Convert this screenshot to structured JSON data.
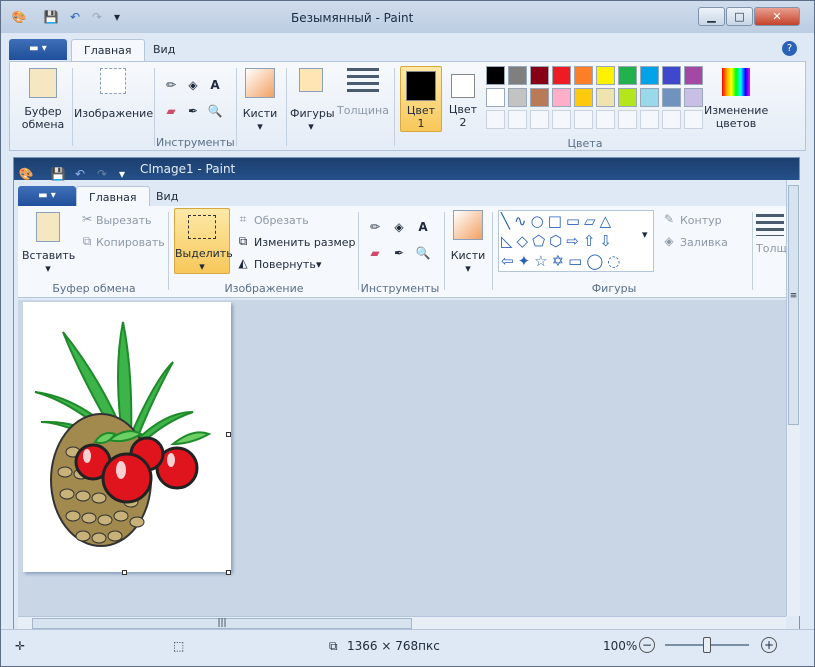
{
  "outer_window": {
    "title": "Безымянный - Paint",
    "tabs": [
      "Главная",
      "Вид"
    ],
    "groups": {
      "clipboard": [
        "Буфер",
        "обмена"
      ],
      "image": "Изображение",
      "tools": "Инструменты",
      "brushes": "Кисти",
      "shapes": "Фигуры",
      "size": "Толщина",
      "color1": [
        "Цвет",
        "1"
      ],
      "color2": [
        "Цвет",
        "2"
      ],
      "edit_colors": [
        "Изменение",
        "цветов"
      ],
      "colors_label": "Цвета"
    },
    "palette_row1": [
      "#000000",
      "#7f7f7f",
      "#880015",
      "#ed1c24",
      "#ff7f27",
      "#fff200",
      "#22b14c",
      "#00a2e8",
      "#3f48cc",
      "#a349a4"
    ],
    "palette_row2": [
      "#ffffff",
      "#c3c3c3",
      "#b97a57",
      "#ffaec9",
      "#ffc90e",
      "#efe4b0",
      "#b5e61d",
      "#99d9ea",
      "#7092be",
      "#c8bfe7"
    ]
  },
  "inner_window": {
    "title": "CImage1 - Paint",
    "tabs": [
      "Главная",
      "Вид"
    ],
    "paste": "Вставить",
    "cut": "Вырезать",
    "copy": "Копировать",
    "clipboard_label": "Буфер обмена",
    "select": "Выделить",
    "crop": "Обрезать",
    "resize": "Изменить размер",
    "rotate": "Повернуть",
    "image_label": "Изображение",
    "tools_label": "Инструменты",
    "brushes": "Кисти",
    "outline": "Контур",
    "fill": "Заливка",
    "shapes_label": "Фигуры",
    "size": "Толщи"
  },
  "status": {
    "dimensions": "1366 × 768пкс",
    "zoom": "100%"
  },
  "colors": {
    "accent": "#1f4f9a",
    "ribbon": "#f5f8fc",
    "canvas_bg": "#c9d6e6"
  }
}
